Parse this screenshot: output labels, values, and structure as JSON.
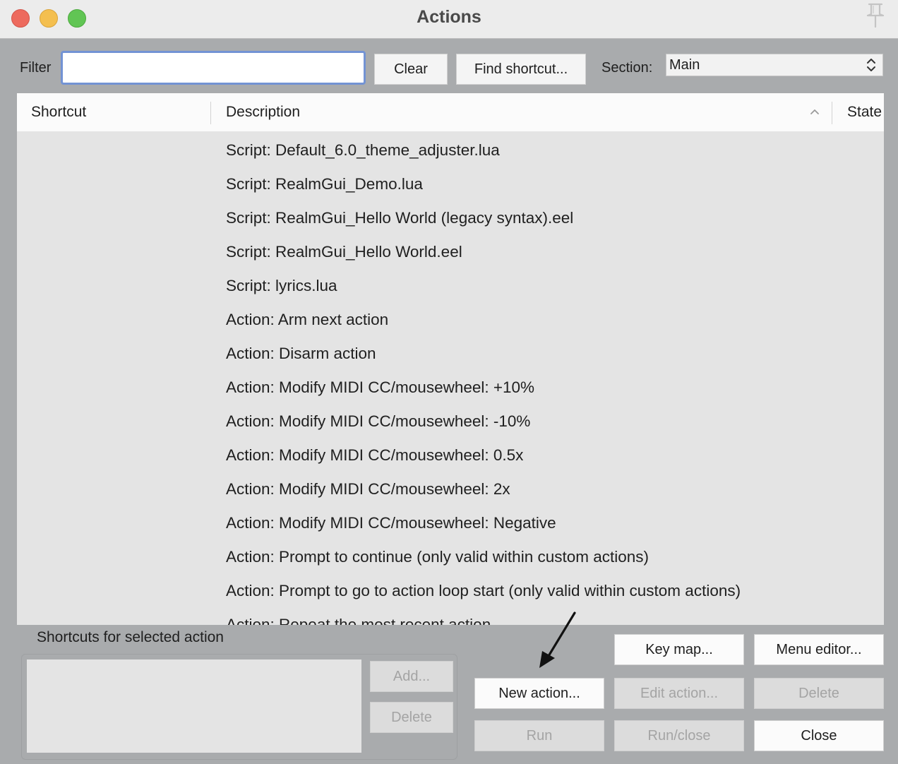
{
  "window": {
    "title": "Actions"
  },
  "toolbar": {
    "filter_label": "Filter",
    "filter_value": "",
    "clear_label": "Clear",
    "find_shortcut_label": "Find shortcut...",
    "section_label": "Section:",
    "section_value": "Main"
  },
  "table": {
    "columns": [
      "Shortcut",
      "Description",
      "State"
    ],
    "sort_column": "Description",
    "rows": [
      {
        "description": "Script: Default_6.0_theme_adjuster.lua"
      },
      {
        "description": "Script: RealmGui_Demo.lua"
      },
      {
        "description": "Script: RealmGui_Hello World (legacy syntax).eel"
      },
      {
        "description": "Script: RealmGui_Hello World.eel"
      },
      {
        "description": "Script: lyrics.lua"
      },
      {
        "description": "Action: Arm next action"
      },
      {
        "description": "Action: Disarm action"
      },
      {
        "description": "Action: Modify MIDI CC/mousewheel: +10%"
      },
      {
        "description": "Action: Modify MIDI CC/mousewheel: -10%"
      },
      {
        "description": "Action: Modify MIDI CC/mousewheel: 0.5x"
      },
      {
        "description": "Action: Modify MIDI CC/mousewheel: 2x"
      },
      {
        "description": "Action: Modify MIDI CC/mousewheel: Negative"
      },
      {
        "description": "Action: Prompt to continue (only valid within custom actions)"
      },
      {
        "description": "Action: Prompt to go to action loop start (only valid within custom actions)"
      },
      {
        "description": "Action: Repeat the most recent action"
      }
    ]
  },
  "shortcuts_panel": {
    "title": "Shortcuts for selected action",
    "add_label": "Add...",
    "delete_label": "Delete"
  },
  "buttons": {
    "key_map": "Key map...",
    "menu_editor": "Menu editor...",
    "new_action": "New action...",
    "edit_action": "Edit action...",
    "delete": "Delete",
    "run": "Run",
    "run_close": "Run/close",
    "close": "Close"
  }
}
